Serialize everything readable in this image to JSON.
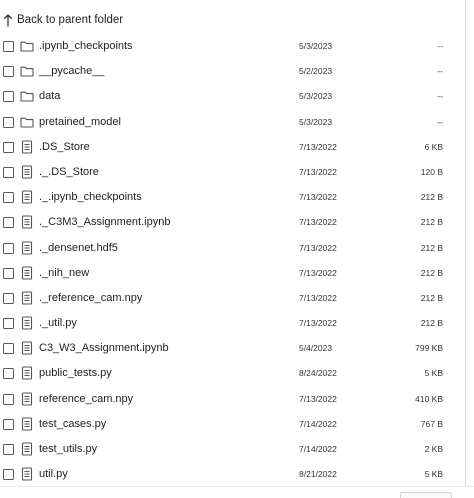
{
  "back_label": "Back to parent folder",
  "files": [
    {
      "name": ".ipynb_checkpoints",
      "type": "folder",
      "date": "5/3/2023",
      "size": "--"
    },
    {
      "name": "__pycache__",
      "type": "folder",
      "date": "5/2/2023",
      "size": "--"
    },
    {
      "name": "data",
      "type": "folder",
      "date": "5/3/2023",
      "size": "--"
    },
    {
      "name": "pretained_model",
      "type": "folder",
      "date": "5/3/2023",
      "size": "--"
    },
    {
      "name": ".DS_Store",
      "type": "file",
      "date": "7/13/2022",
      "size": "6 KB"
    },
    {
      "name": "._.DS_Store",
      "type": "file",
      "date": "7/13/2022",
      "size": "120 B"
    },
    {
      "name": "._.ipynb_checkpoints",
      "type": "file",
      "date": "7/13/2022",
      "size": "212 B"
    },
    {
      "name": "._C3M3_Assignment.ipynb",
      "type": "file",
      "date": "7/13/2022",
      "size": "212 B"
    },
    {
      "name": "._densenet.hdf5",
      "type": "file",
      "date": "7/13/2022",
      "size": "212 B"
    },
    {
      "name": "._nih_new",
      "type": "file",
      "date": "7/13/2022",
      "size": "212 B"
    },
    {
      "name": "._reference_cam.npy",
      "type": "file",
      "date": "7/13/2022",
      "size": "212 B"
    },
    {
      "name": "._util.py",
      "type": "file",
      "date": "7/13/2022",
      "size": "212 B"
    },
    {
      "name": "C3_W3_Assignment.ipynb",
      "type": "file",
      "date": "5/4/2023",
      "size": "799 KB"
    },
    {
      "name": "public_tests.py",
      "type": "file",
      "date": "8/24/2022",
      "size": "5 KB"
    },
    {
      "name": "reference_cam.npy",
      "type": "file",
      "date": "7/13/2022",
      "size": "410 KB"
    },
    {
      "name": "test_cases.py",
      "type": "file",
      "date": "7/14/2022",
      "size": "767 B"
    },
    {
      "name": "test_utils.py",
      "type": "file",
      "date": "7/14/2022",
      "size": "2 KB"
    },
    {
      "name": "util.py",
      "type": "file",
      "date": "8/21/2022",
      "size": "5 KB"
    }
  ]
}
